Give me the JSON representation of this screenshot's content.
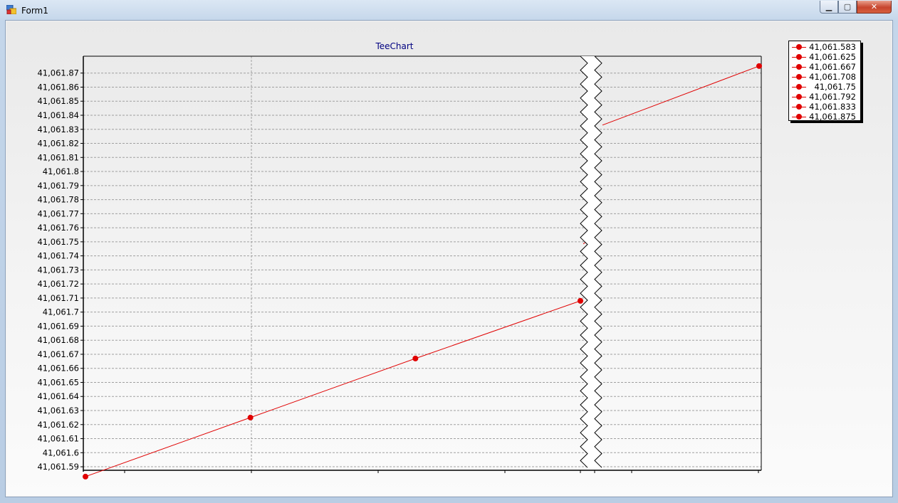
{
  "window": {
    "title": "Form1",
    "minimize_icon": "minimize-icon",
    "maximize_icon": "maximize-icon",
    "close_icon": "close-icon"
  },
  "colors": {
    "series": "#e00000",
    "title": "#000080",
    "grid": "#a0a0a0"
  },
  "chart_data": {
    "type": "line",
    "title": "TeeChart",
    "xlabel": "",
    "ylabel": "",
    "ylim": [
      41061.5875,
      41061.882
    ],
    "grid": true,
    "axis_break": true,
    "legend_position": "top-right",
    "y_ticks": [
      "41,061.59",
      "41,061.6",
      "41,061.61",
      "41,061.62",
      "41,061.63",
      "41,061.64",
      "41,061.65",
      "41,061.66",
      "41,061.67",
      "41,061.68",
      "41,061.69",
      "41,061.7",
      "41,061.71",
      "41,061.72",
      "41,061.73",
      "41,061.74",
      "41,061.75",
      "41,061.76",
      "41,061.77",
      "41,061.78",
      "41,061.79",
      "41,061.8",
      "41,061.81",
      "41,061.82",
      "41,061.83",
      "41,061.84",
      "41,061.85",
      "41,061.86",
      "41,061.87"
    ],
    "legend": [
      "41,061.583",
      "41,061.625",
      "41,061.667",
      "41,061.708",
      "41,061.75",
      "41,061.792",
      "41,061.833",
      "41,061.875"
    ],
    "series": [
      {
        "x": [
          0,
          1,
          2,
          3,
          4,
          5,
          6,
          7
        ],
        "values": [
          41061.583,
          41061.625,
          41061.667,
          41061.708,
          41061.75,
          41061.792,
          41061.833,
          41061.875
        ]
      }
    ]
  }
}
